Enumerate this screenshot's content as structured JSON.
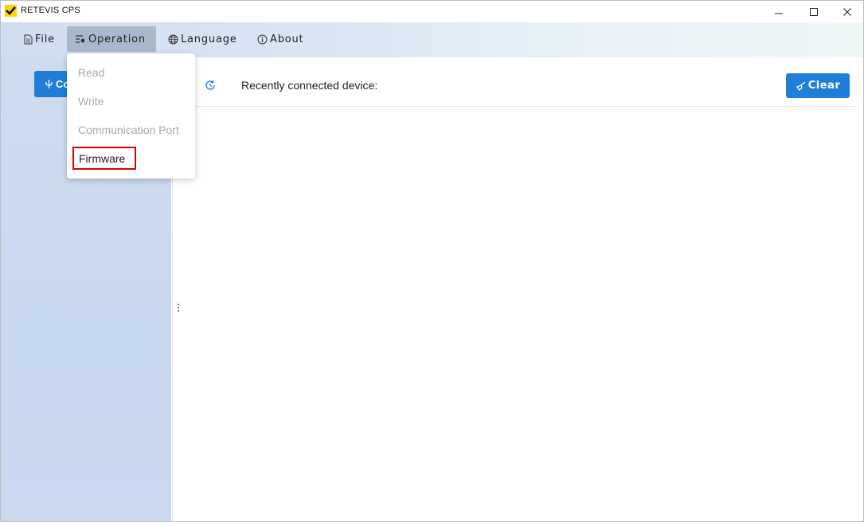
{
  "window": {
    "title": "RETEVIS CPS",
    "controls": [
      "minimize",
      "maximize",
      "close"
    ]
  },
  "menubar": {
    "file": "File",
    "operation": "Operation",
    "language": "Language",
    "about": "About",
    "active": "Operation"
  },
  "operation_menu": {
    "items": [
      {
        "label": "Read",
        "enabled": false
      },
      {
        "label": "Write",
        "enabled": false
      },
      {
        "label": "Communication Port",
        "enabled": false
      },
      {
        "label": "Firmware",
        "enabled": true,
        "highlighted": true
      }
    ]
  },
  "sidebar": {
    "connect_label": "Co"
  },
  "main": {
    "recent_label": "Recently connected device:",
    "clear_label": "Clear"
  },
  "colors": {
    "accent": "#1f7fd8",
    "highlight_border": "#e00000",
    "disabled_text": "#a9a9a9"
  },
  "icons": [
    "app-logo-icon",
    "file-icon",
    "operation-icon",
    "globe-icon",
    "info-icon",
    "usb-icon",
    "history-icon",
    "broom-icon",
    "drag-handle-icon"
  ]
}
